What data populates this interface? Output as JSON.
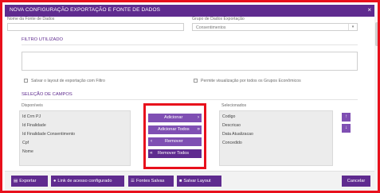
{
  "dialog": {
    "title": "NOVA CONFIGURAÇÃO EXPORTAÇÃO E FONTE DE DADOS",
    "close_glyph": "×"
  },
  "form": {
    "nome_label": "Nome da Fonte de Dados",
    "nome_value": "",
    "grupo_label": "Grupo de Dados Exportação",
    "grupo_value": "Consentimentos",
    "filtro_title": "FILTRO UTILIZADO",
    "filtro_value": "",
    "salvar_layout_label": "Salvar o layout de exportação com Filtro",
    "permite_label": "Permite visualização por todos os Grupos Econômicos"
  },
  "fields": {
    "section_title": "SELEÇÃO DE CAMPOS",
    "available_label": "Disponíveis",
    "available": [
      "Id Crm PJ",
      "Id Finalidade",
      "Id Finalidade Consentimento",
      "Cpf",
      "Nome"
    ],
    "selected_label": "Selecionados",
    "selected": [
      "Codigo",
      "Descricao",
      "Data Atualizacao",
      "Concedido"
    ]
  },
  "move_buttons": {
    "add": "Adicionar",
    "add_all": "Adicionar Todos",
    "remove": "Remover",
    "remove_all": "Remover Todos"
  },
  "footer": {
    "exportar": "Exportar",
    "link": "Link de acesso configurado",
    "fontes": "Fontes Salvas",
    "salvar_layout": "Salvar Layout",
    "cancelar": "Cancelar"
  },
  "colors": {
    "brand_purple": "#5f2b8f",
    "button_purple": "#7f4fb3",
    "highlight_red": "#e8101c"
  },
  "icons": {
    "exportar": "document-icon",
    "link": "globe-icon",
    "fontes": "list-icon",
    "salvar_layout": "save-icon",
    "move_up": "arrow-up-icon",
    "move_down": "arrow-down-icon"
  }
}
